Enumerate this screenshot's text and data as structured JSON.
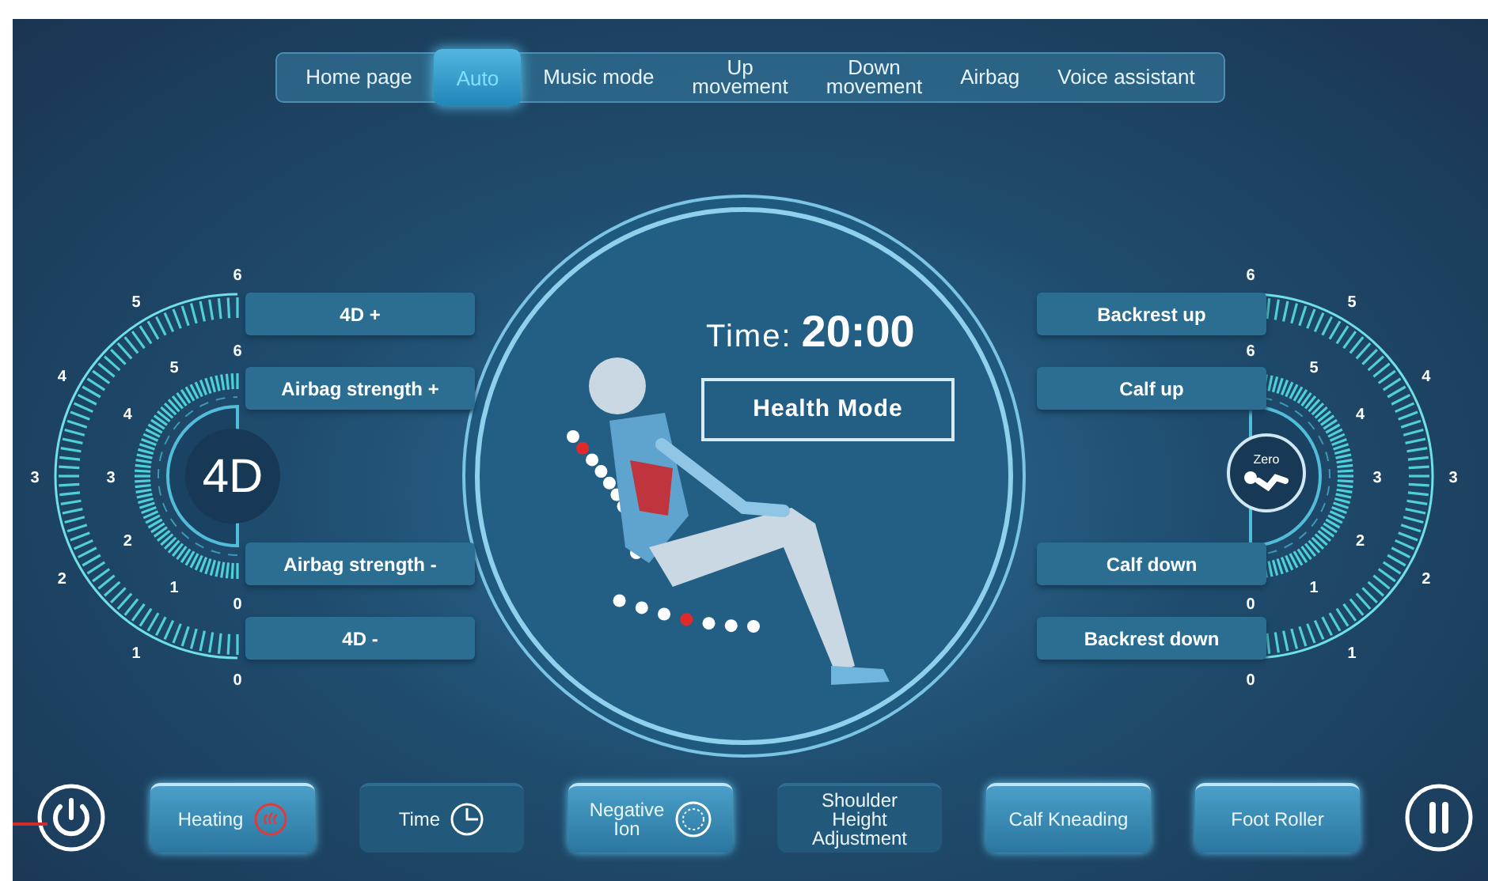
{
  "tabs": [
    {
      "label": "Home page",
      "selected": false
    },
    {
      "label": "Auto",
      "selected": true
    },
    {
      "label": "Music mode",
      "selected": false
    },
    {
      "label": "Up\nmovement",
      "selected": false
    },
    {
      "label": "Down\nmovement",
      "selected": false
    },
    {
      "label": "Airbag",
      "selected": false
    },
    {
      "label": "Voice assistant",
      "selected": false
    }
  ],
  "left_panel": {
    "dial_label": "4D",
    "outer_ticks": [
      "0",
      "1",
      "2",
      "3",
      "4",
      "5",
      "6"
    ],
    "inner_ticks": [
      "0",
      "1",
      "2",
      "3",
      "4",
      "5",
      "6"
    ],
    "buttons": [
      "4D +",
      "Airbag strength +",
      "Airbag strength -",
      "4D -"
    ]
  },
  "center": {
    "time_label": "Time:",
    "time_value": "20:00",
    "mode": "Health Mode"
  },
  "right_panel": {
    "dial_label": "Zero",
    "outer_ticks": [
      "0",
      "1",
      "2",
      "3",
      "4",
      "5",
      "6"
    ],
    "inner_ticks": [
      "0",
      "1",
      "2",
      "3",
      "4",
      "5",
      "6"
    ],
    "buttons": [
      "Backrest up",
      "Calf up",
      "Calf down",
      "Backrest down"
    ]
  },
  "bottom_bar": {
    "buttons": [
      {
        "label": "Heating",
        "kind": "heat",
        "active": true,
        "on": true
      },
      {
        "label": "Time",
        "kind": "clock",
        "active": false,
        "on": false
      },
      {
        "label": "Negative\nIon",
        "kind": "ion",
        "active": true,
        "on": false
      },
      {
        "label": "Shoulder\nHeight\nAdjustment",
        "kind": "plain",
        "active": false,
        "on": false
      },
      {
        "label": "Calf Kneading",
        "kind": "plain",
        "active": true,
        "on": false
      },
      {
        "label": "Foot Roller",
        "kind": "plain",
        "active": true,
        "on": false
      }
    ]
  }
}
